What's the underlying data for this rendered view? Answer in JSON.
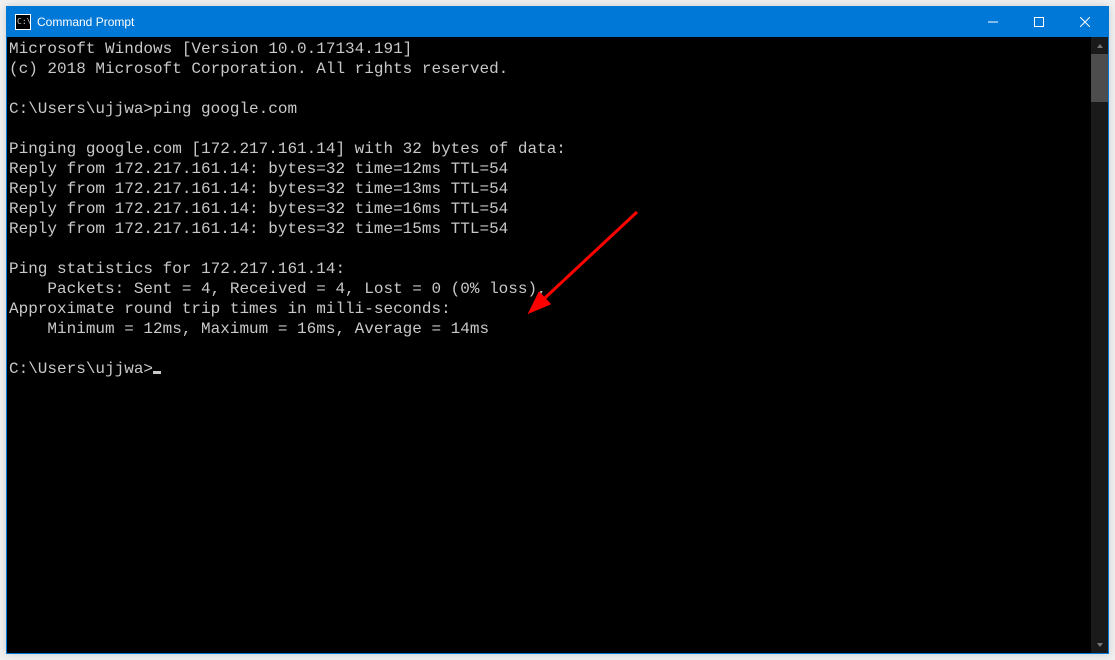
{
  "window": {
    "title": "Command Prompt",
    "icon_text": "C:\\."
  },
  "terminal": {
    "lines": [
      "Microsoft Windows [Version 10.0.17134.191]",
      "(c) 2018 Microsoft Corporation. All rights reserved.",
      "",
      "C:\\Users\\ujjwa>ping google.com",
      "",
      "Pinging google.com [172.217.161.14] with 32 bytes of data:",
      "Reply from 172.217.161.14: bytes=32 time=12ms TTL=54",
      "Reply from 172.217.161.14: bytes=32 time=13ms TTL=54",
      "Reply from 172.217.161.14: bytes=32 time=16ms TTL=54",
      "Reply from 172.217.161.14: bytes=32 time=15ms TTL=54",
      "",
      "Ping statistics for 172.217.161.14:",
      "    Packets: Sent = 4, Received = 4, Lost = 0 (0% loss),",
      "Approximate round trip times in milli-seconds:",
      "    Minimum = 12ms, Maximum = 16ms, Average = 14ms",
      "",
      "C:\\Users\\ujjwa>"
    ]
  },
  "annotation": {
    "color": "#ff0000"
  }
}
